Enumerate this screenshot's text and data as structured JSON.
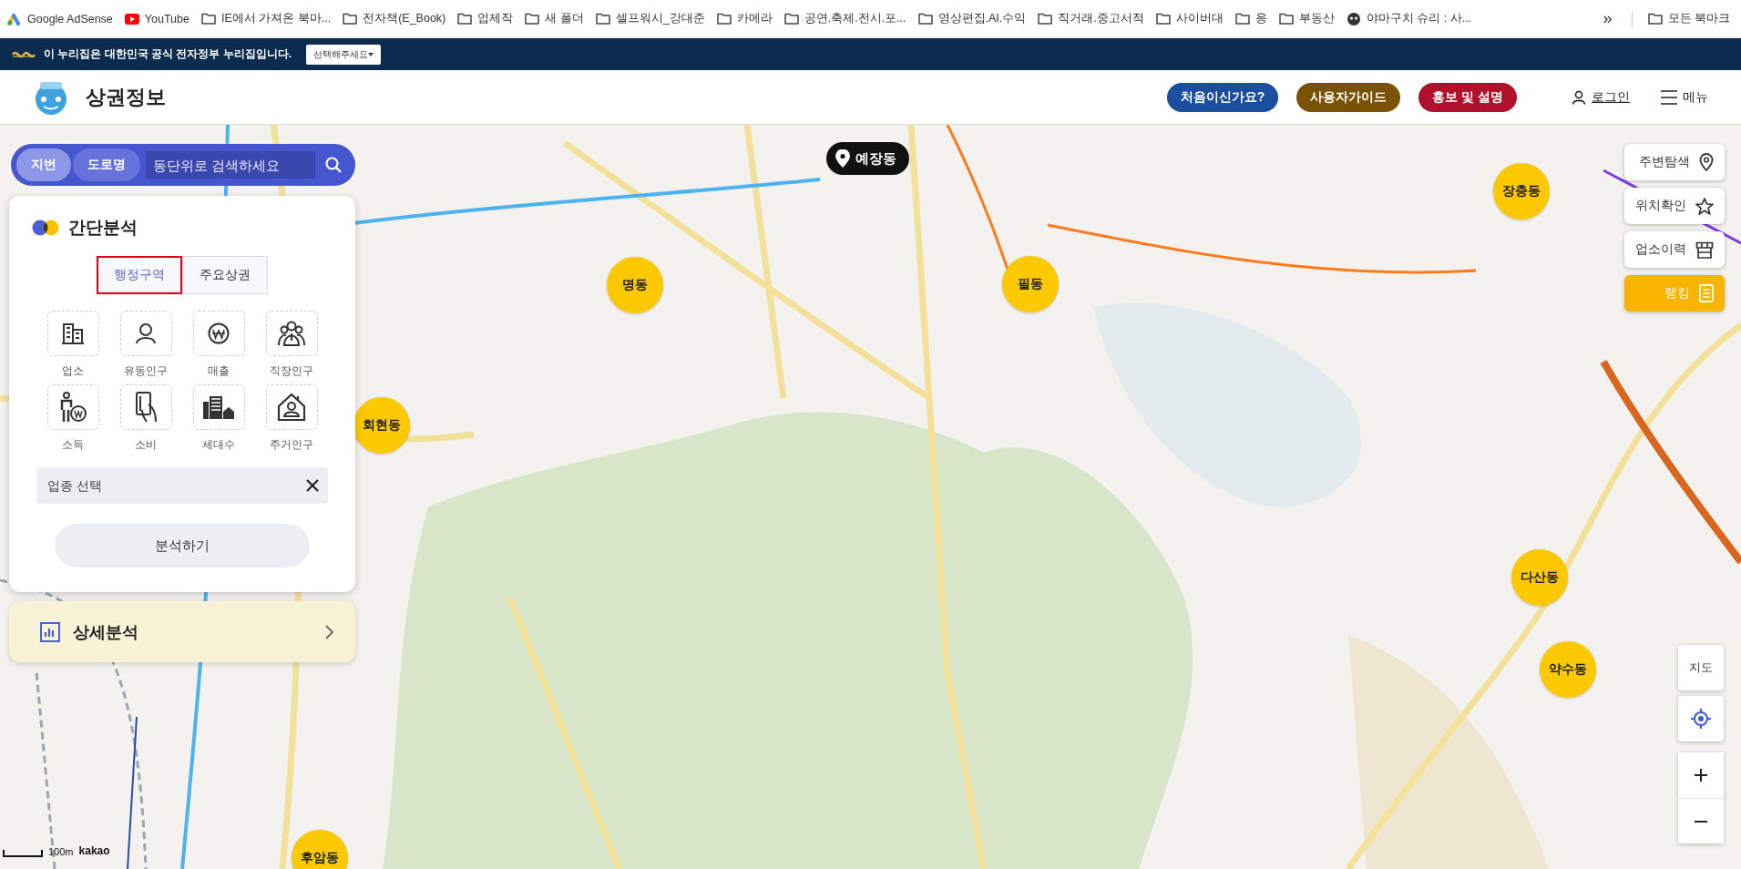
{
  "bookmarks_bar": {
    "items": [
      {
        "label": "Google AdSense",
        "kind": "adsense"
      },
      {
        "label": "YouTube",
        "kind": "youtube"
      },
      {
        "label": "IE에서 가져온 북마...",
        "kind": "folder"
      },
      {
        "label": "전자책(E_Book)",
        "kind": "folder"
      },
      {
        "label": "업제작",
        "kind": "folder"
      },
      {
        "label": "새 폴더",
        "kind": "folder"
      },
      {
        "label": "셀프워시_강대준",
        "kind": "folder"
      },
      {
        "label": "카메라",
        "kind": "folder"
      },
      {
        "label": "공연.축제.전시.포...",
        "kind": "folder"
      },
      {
        "label": "영상편집.AI.수익",
        "kind": "folder"
      },
      {
        "label": "직거래.중고서적",
        "kind": "folder"
      },
      {
        "label": "사이버대",
        "kind": "folder"
      },
      {
        "label": "응",
        "kind": "folder"
      },
      {
        "label": "부동산",
        "kind": "folder"
      },
      {
        "label": "야마구치 슈리 : 사...",
        "kind": "site"
      }
    ],
    "overflow": "»",
    "all_bookmarks": "모든 북마크"
  },
  "gov_banner": {
    "text": "이 누리집은 대한민국 공식 전자정부 누리집입니다.",
    "select": "선택해주세요"
  },
  "header": {
    "title": "상권정보",
    "buttons": [
      {
        "label": "처음이신가요?",
        "color": "#1a4e9e"
      },
      {
        "label": "사용자가이드",
        "color": "#7a5205"
      },
      {
        "label": "홍보 및 설명",
        "color": "#b0102c"
      }
    ],
    "login": "로그인",
    "menu": "메뉴"
  },
  "search": {
    "tabs": [
      {
        "label": "지번",
        "selected": true
      },
      {
        "label": "도로명",
        "selected": false
      }
    ],
    "placeholder": "동단위로 검색하세요"
  },
  "quick_analysis": {
    "title": "간단분석",
    "tabs": [
      {
        "label": "행정구역",
        "selected": true
      },
      {
        "label": "주요상권",
        "selected": false
      }
    ],
    "categories": [
      {
        "label": "업소",
        "kind": "building"
      },
      {
        "label": "유동인구",
        "kind": "person"
      },
      {
        "label": "매출",
        "kind": "won"
      },
      {
        "label": "직장인구",
        "kind": "group"
      },
      {
        "label": "소득",
        "kind": "income"
      },
      {
        "label": "소비",
        "kind": "card"
      },
      {
        "label": "세대수",
        "kind": "houses"
      },
      {
        "label": "주거인구",
        "kind": "home"
      }
    ],
    "industry_field": {
      "placeholder": "업종 선택"
    },
    "analyze_button": "분석하기"
  },
  "detail_analysis": {
    "title": "상세분석"
  },
  "map": {
    "districts": [
      {
        "label": "명동"
      },
      {
        "label": "필동"
      },
      {
        "label": "장충동"
      },
      {
        "label": "회현동"
      },
      {
        "label": "다산동"
      },
      {
        "label": "약수동"
      },
      {
        "label": "후암동"
      }
    ],
    "focused_place": "예장동",
    "scale": "100m",
    "attribution": "kakao"
  },
  "side_tools": [
    {
      "label": "주변탐색",
      "kind": "pin",
      "selected": false
    },
    {
      "label": "위치확인",
      "kind": "star",
      "selected": false
    },
    {
      "label": "업소이력",
      "kind": "store",
      "selected": false
    },
    {
      "label": "랭킹",
      "kind": "list",
      "selected": true
    }
  ],
  "map_controls": {
    "map_type": "지도"
  }
}
